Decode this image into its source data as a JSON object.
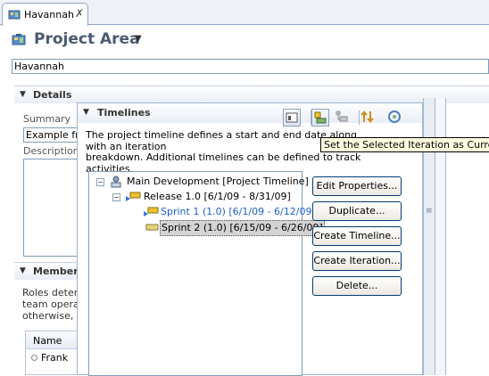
{
  "editor_tab": {
    "label": "Havannah",
    "close_glyph": "✗"
  },
  "header": {
    "title": "Project Area",
    "name_value": "Havannah"
  },
  "details": {
    "title": "Details",
    "summary_label": "Summary",
    "summary_value": "Example fro",
    "description_label": "Description"
  },
  "members": {
    "title": "Member",
    "text": [
      "Roles deterr",
      "team operat",
      "otherwise, a"
    ],
    "column": "Name",
    "row": "Frank"
  },
  "timelines": {
    "title": "Timelines",
    "description_lines": [
      "The project timeline defines a start and end date along with an iteration",
      "breakdown. Additional timelines can be defined to track",
      "activities."
    ],
    "toolbar_icons": [
      "properties-icon",
      "set-current-iteration-icon",
      "iteration-tree-icon",
      "move-up-down-icon",
      "refresh-icon"
    ],
    "tree": [
      {
        "text": "Main Development [Project Timeline]",
        "icon": "timeline-icon"
      },
      {
        "text": "Release 1.0 [6/1/09 - 8/31/09]",
        "icon": "iteration-current-icon"
      },
      {
        "text": "Sprint 1 (1.0) [6/1/09 - 6/12/09]",
        "icon": "iteration-active-icon"
      },
      {
        "text": "Sprint 2 (1.0) [6/15/09 - 6/26/09]",
        "icon": "iteration-icon"
      }
    ],
    "buttons": [
      "Edit Properties...",
      "Duplicate...",
      "Create Timeline...",
      "Create Iteration...",
      "Delete..."
    ]
  },
  "tooltip": "Set the Selected Iteration as Current",
  "colors": {
    "link_blue": "#1f5fcc",
    "accent_border": "#7f9db9",
    "tooltip_bg": "#ffffe1"
  }
}
